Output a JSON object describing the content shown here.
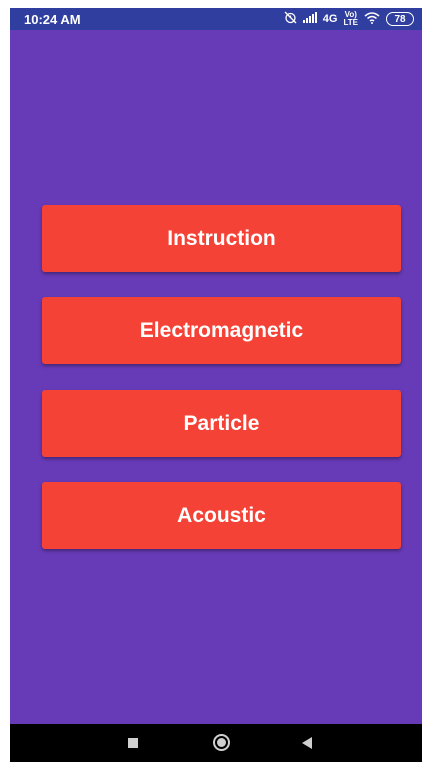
{
  "status_bar": {
    "time": "10:24 AM",
    "alarm_icon": "alarm-off-icon",
    "signal_text": ".ıl",
    "network_type": "4G",
    "volte_top": "Vo)",
    "volte_bottom": "LTE",
    "wifi_icon": "wifi-icon",
    "battery_level": "78"
  },
  "main": {
    "buttons": [
      {
        "label": "Instruction"
      },
      {
        "label": "Electromagnetic"
      },
      {
        "label": "Particle"
      },
      {
        "label": "Acoustic"
      }
    ]
  },
  "nav_bar": {
    "recents_icon": "recents-square-icon",
    "home_icon": "home-circle-icon",
    "back_icon": "back-triangle-icon"
  },
  "colors": {
    "status_bar": "#303f9f",
    "background": "#673ab7",
    "button": "#f44336",
    "button_text": "#ffffff",
    "nav_bar": "#000000"
  }
}
